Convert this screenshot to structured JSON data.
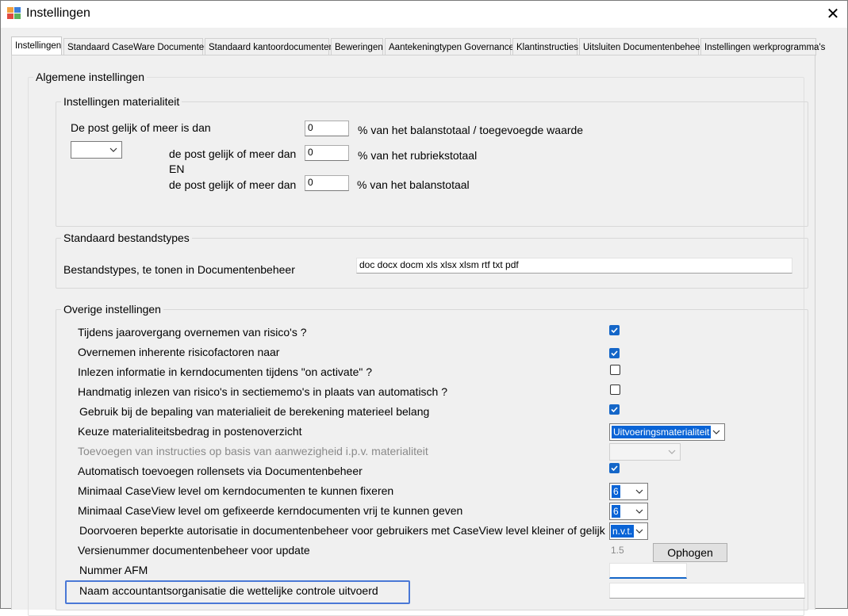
{
  "window": {
    "title": "Instellingen",
    "close_label": "✕"
  },
  "tabs": [
    "Instellingen",
    "Standaard CaseWare Documenten",
    "Standaard kantoordocumenten",
    "Beweringen",
    "Aantekeningtypen Governance",
    "Klantinstructies",
    "Uitsluiten Documentenbeheer",
    "Instellingen werkprogramma's"
  ],
  "general": {
    "title": "Algemene instellingen",
    "materiality": {
      "title": "Instellingen materialiteit",
      "row1_label": "De post gelijk of meer is dan",
      "row1_value": "0",
      "row1_suffix": "% van het balanstotaal / toegevoegde waarde",
      "row2_label": "de post gelijk of meer dan",
      "row2_value": "0",
      "row2_suffix": "% van het rubriekstotaal",
      "en_label": "EN",
      "row3_label": "de post gelijk of meer dan",
      "row3_value": "0",
      "row3_suffix": "% van het balanstotaal",
      "combo_value": ""
    },
    "filetypes": {
      "title": "Standaard bestandstypes",
      "label": "Bestandstypes, te tonen in Documentenbeheer",
      "value": "doc docx docm xls xlsx xlsm rtf txt pdf"
    },
    "other": {
      "title": "Overige instellingen",
      "risk_carryover": {
        "label": "Tijdens jaarovergang overnemen van risico's ?",
        "checked": true
      },
      "inherent_risk": {
        "label": "Overnemen inherente risicofactoren naar",
        "checked": true
      },
      "read_info": {
        "label": "Inlezen informatie in kerndocumenten tijdens \"on activate\" ?",
        "checked": false
      },
      "manual_read": {
        "label": "Handmatig inlezen van risico's in sectiememo's in plaats van automatisch ?",
        "checked": false
      },
      "calc_materiality": {
        "label": "Gebruik bij de bepaling van materialieit de berekening materieel belang",
        "checked": true
      },
      "materiality_amount": {
        "label": "Keuze materialiteitsbedrag in postenoverzicht",
        "value": "Uitvoeringsmaterialiteit"
      },
      "instructions": {
        "label": "Toevoegen van instructies op basis van aanwezigheid i.p.v. materialiteit",
        "value": ""
      },
      "rollensets": {
        "label": "Automatisch toevoegen rollensets via Documentenbeheer",
        "checked": true
      },
      "min_level_fix": {
        "label": "Minimaal CaseView level om kerndocumenten te kunnen fixeren",
        "value": "6"
      },
      "min_level_release": {
        "label": "Minimaal CaseView level om gefixeerde kerndocumenten vrij te kunnen geven",
        "value": "6"
      },
      "restricted_auth": {
        "label": "Doorvoeren beperkte autorisatie in documentenbeheer voor gebruikers met CaseView level kleiner of gelijk",
        "value": "n.v.t."
      },
      "version": {
        "label": "Versienummer documentenbeheer voor update",
        "value": "1.5",
        "button": "Ophogen"
      },
      "afm": {
        "label": "Nummer AFM",
        "value": ""
      },
      "org_name": {
        "label": "Naam accountantsorganisatie die wettelijke controle uitvoerd",
        "value": ""
      }
    }
  },
  "colors": {
    "accent": "#1466c8",
    "selection": "#0a64d6",
    "focus": "#4a78d6"
  }
}
